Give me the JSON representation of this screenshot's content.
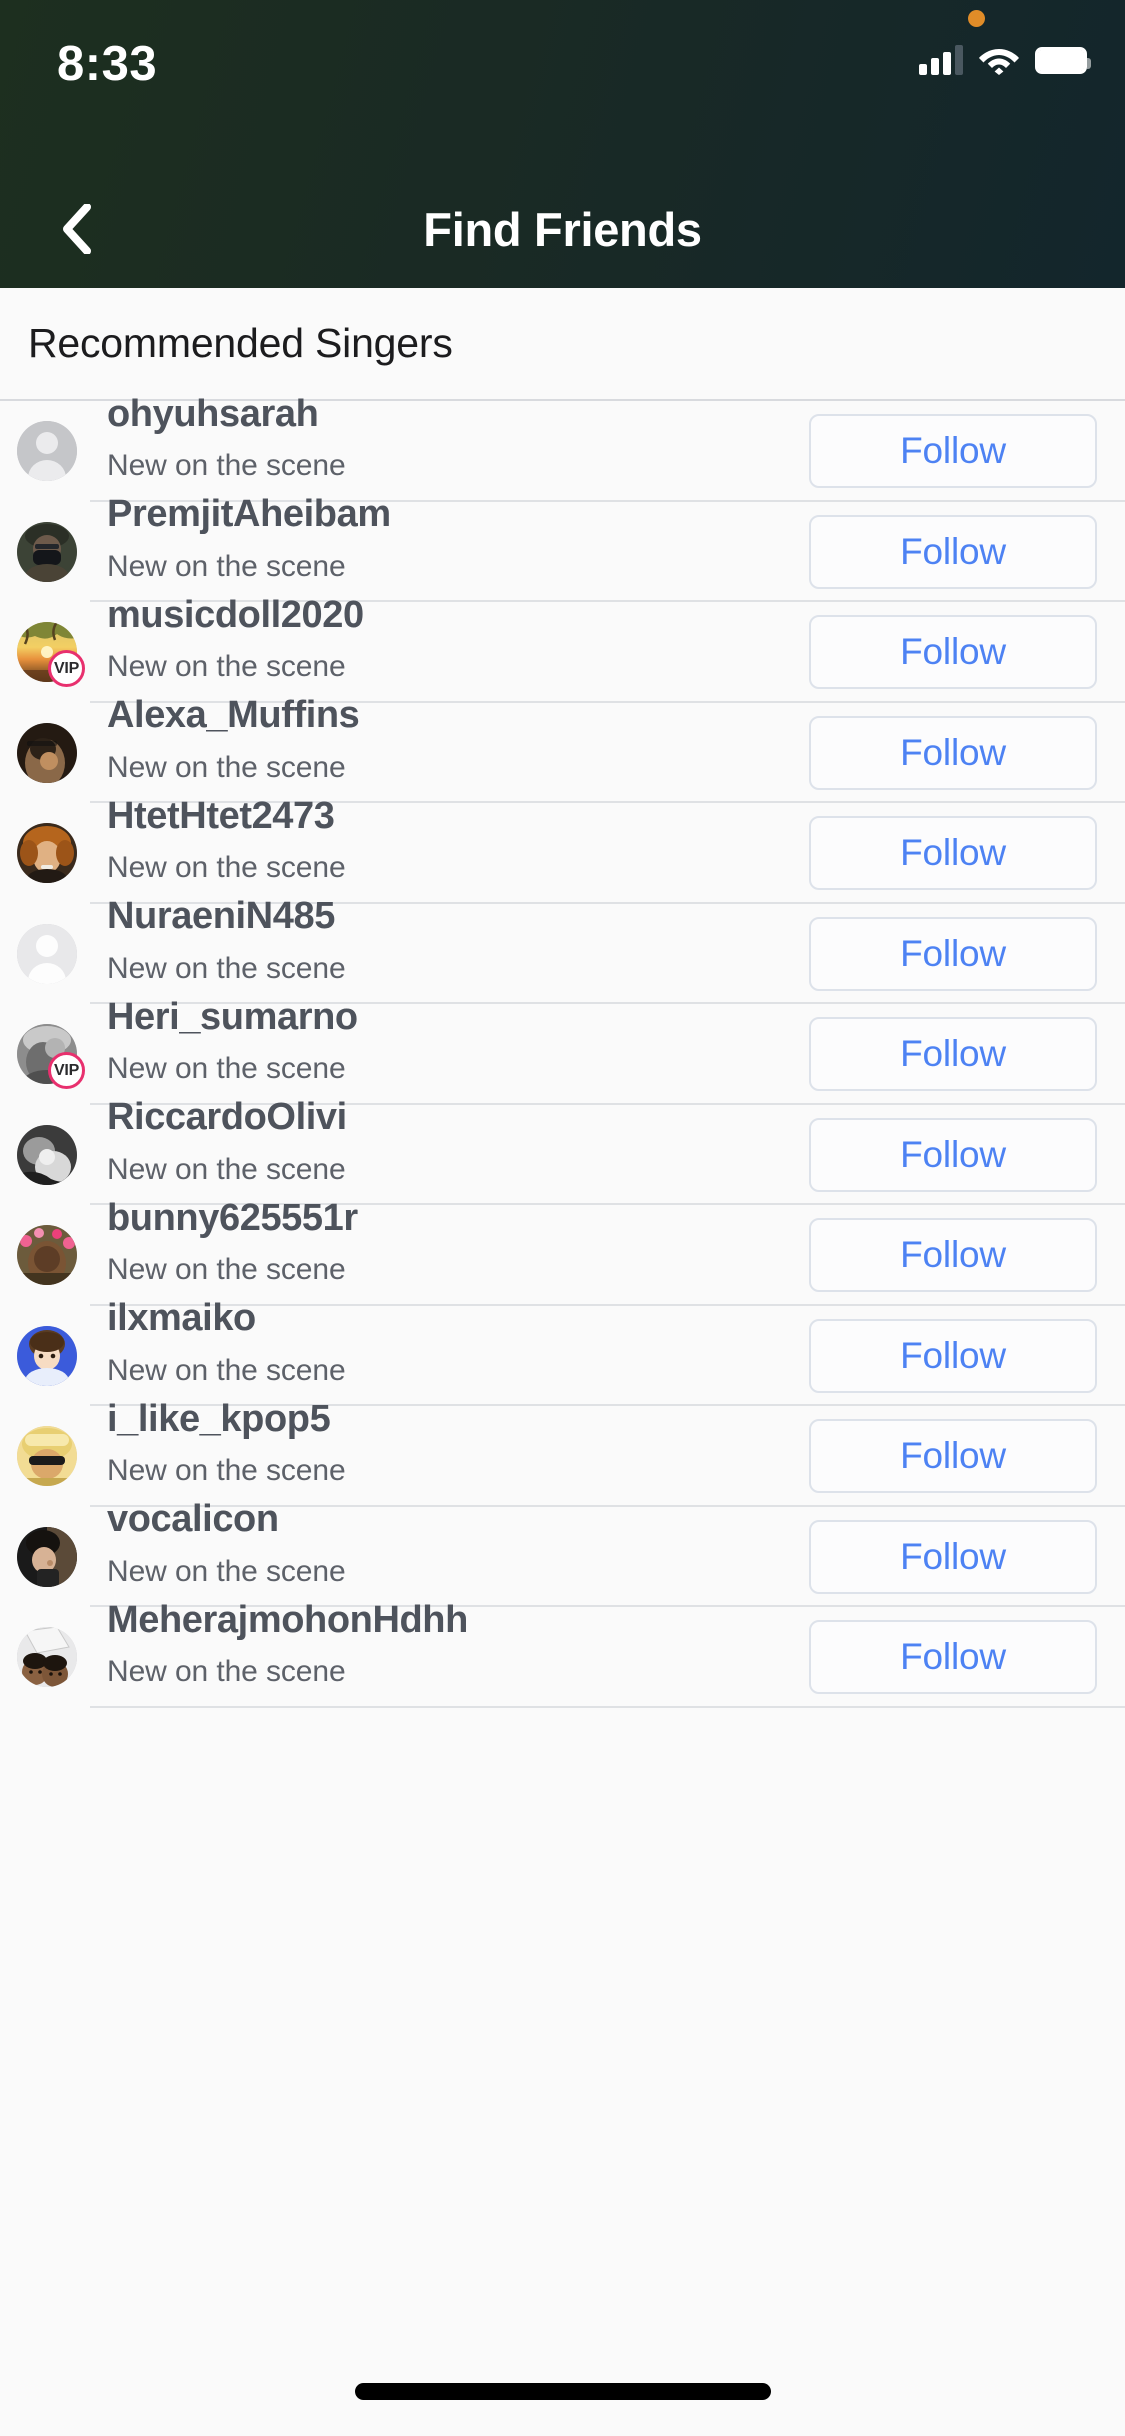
{
  "status_bar": {
    "time": "8:33",
    "icons": {
      "recording_dot": "orange-dot-icon",
      "cellular": "cellular-signal-icon",
      "wifi": "wifi-icon",
      "battery": "battery-icon"
    },
    "colors": {
      "recording_dot": "#e08c28",
      "foreground": "#ffffff"
    }
  },
  "nav": {
    "back_icon": "chevron-left-icon",
    "title": "Find Friends",
    "gradient_start": "#1d2f1f",
    "gradient_end": "#13262c"
  },
  "section": {
    "title": "Recommended Singers"
  },
  "follow_label": "Follow",
  "subtitle_text": "New on the scene",
  "colors": {
    "follow_text": "#4d82f3",
    "follow_border": "#dde2ea",
    "username": "#4e535c",
    "subtitle": "#5d6169",
    "divider": "#dfe1e4",
    "vip_ring": "#e8306e",
    "page_bg": "#fafafa"
  },
  "vip_label": "VIP",
  "users": [
    {
      "username": "ohyuhsarah",
      "subtitle": "New on the scene",
      "action": "Follow",
      "vip": false,
      "avatar": "placeholder-gray"
    },
    {
      "username": "PremjitAheibam",
      "subtitle": "New on the scene",
      "action": "Follow",
      "vip": false,
      "avatar": "photo-person-mask"
    },
    {
      "username": "musicdoll2020",
      "subtitle": "New on the scene",
      "action": "Follow",
      "vip": true,
      "avatar": "photo-sunset-tree"
    },
    {
      "username": "Alexa_Muffins",
      "subtitle": "New on the scene",
      "action": "Follow",
      "vip": false,
      "avatar": "photo-dark-portrait"
    },
    {
      "username": "HtetHtet2473",
      "subtitle": "New on the scene",
      "action": "Follow",
      "vip": false,
      "avatar": "photo-curly-hair"
    },
    {
      "username": "NuraeniN485",
      "subtitle": "New on the scene",
      "action": "Follow",
      "vip": false,
      "avatar": "placeholder-light"
    },
    {
      "username": "Heri_sumarno",
      "subtitle": "New on the scene",
      "action": "Follow",
      "vip": true,
      "avatar": "photo-bw-person"
    },
    {
      "username": "RiccardoOlivi",
      "subtitle": "New on the scene",
      "action": "Follow",
      "vip": false,
      "avatar": "photo-bw-baby"
    },
    {
      "username": "bunny625551r",
      "subtitle": "New on the scene",
      "action": "Follow",
      "vip": false,
      "avatar": "photo-flower-crown"
    },
    {
      "username": "ilxmaiko",
      "subtitle": "New on the scene",
      "action": "Follow",
      "vip": false,
      "avatar": "photo-anime-blue"
    },
    {
      "username": "i_like_kpop5",
      "subtitle": "New on the scene",
      "action": "Follow",
      "vip": false,
      "avatar": "photo-sunglasses-yellow"
    },
    {
      "username": "vocalicon",
      "subtitle": "New on the scene",
      "action": "Follow",
      "vip": false,
      "avatar": "photo-dark-person"
    },
    {
      "username": "MeherajmohonHdhh",
      "subtitle": "New on the scene",
      "action": "Follow",
      "vip": false,
      "avatar": "photo-two-kids"
    }
  ]
}
